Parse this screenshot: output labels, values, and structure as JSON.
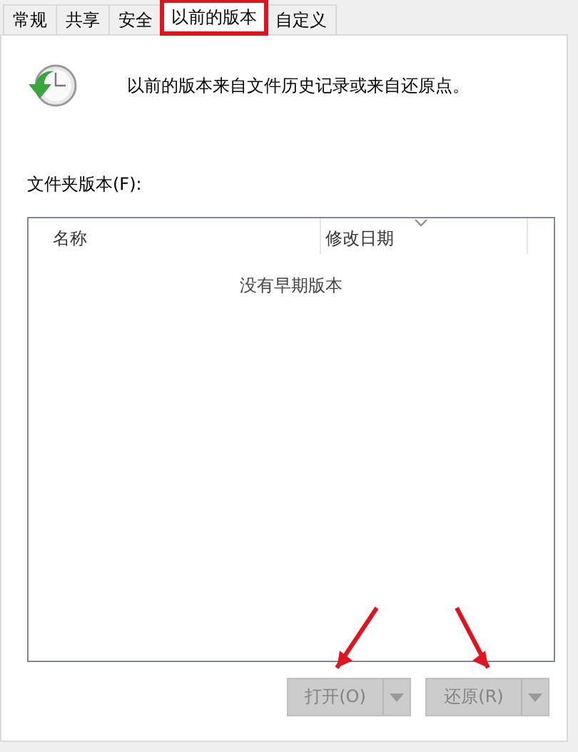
{
  "tabs": [
    {
      "label": "常规",
      "selected": false,
      "annotated": false
    },
    {
      "label": "共享",
      "selected": false,
      "annotated": false
    },
    {
      "label": "安全",
      "selected": false,
      "annotated": false
    },
    {
      "label": "以前的版本",
      "selected": true,
      "annotated": true
    },
    {
      "label": "自定义",
      "selected": false,
      "annotated": false
    }
  ],
  "info_text": "以前的版本来自文件历史记录或来自还原点。",
  "list_label": "文件夹版本(F):",
  "list": {
    "columns": [
      {
        "label": "名称",
        "sorted": false
      },
      {
        "label": "修改日期",
        "sorted": true
      }
    ],
    "empty_text": "没有早期版本"
  },
  "buttons": [
    {
      "label": "打开(O)",
      "disabled": true,
      "annotated": true
    },
    {
      "label": "还原(R)",
      "disabled": true,
      "annotated": true
    }
  ]
}
